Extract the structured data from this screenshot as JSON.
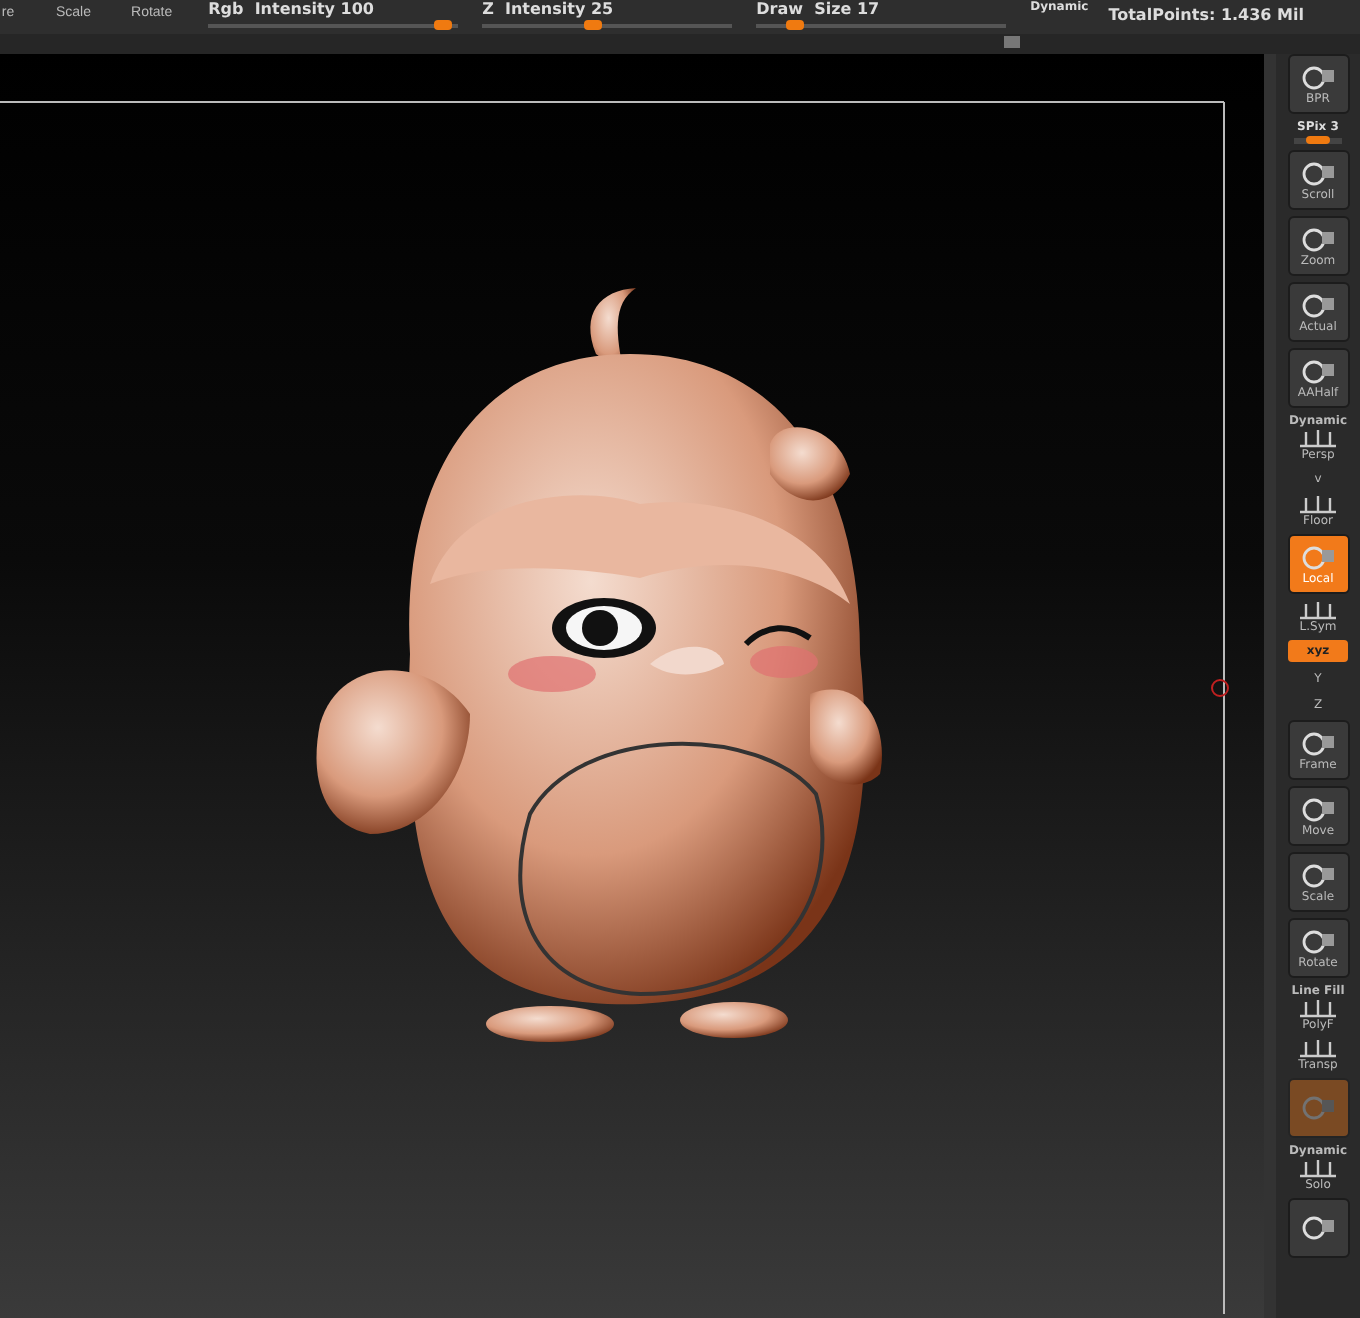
{
  "top_bar": {
    "tools": [
      {
        "label": "re"
      },
      {
        "label": "Scale"
      },
      {
        "label": "Rotate"
      }
    ],
    "sliders": [
      {
        "label": "Rgb",
        "name": "Intensity",
        "value": "100",
        "level": 0.94
      },
      {
        "label": "Z",
        "name": "Intensity",
        "value": "25",
        "level": 0.45
      },
      {
        "label": "Draw",
        "name": "Size",
        "value": "17",
        "level": 0.16
      }
    ],
    "dynamic_label": "Dynamic",
    "total_points": "TotalPoints: 1.436 Mil"
  },
  "toolbar": [
    {
      "kind": "button",
      "label": "BPR",
      "selected": false,
      "disabled": false
    },
    {
      "kind": "slider",
      "label": "SPix 3",
      "level": 0.5
    },
    {
      "kind": "button",
      "label": "Scroll",
      "selected": false,
      "disabled": false
    },
    {
      "kind": "button",
      "label": "Zoom",
      "selected": false,
      "disabled": false
    },
    {
      "kind": "button",
      "label": "Actual",
      "selected": false,
      "disabled": false
    },
    {
      "kind": "button",
      "label": "AAHalf",
      "selected": false,
      "disabled": false
    },
    {
      "kind": "flat",
      "header": "Dynamic",
      "label": "Persp",
      "selected": false,
      "disabled": false
    },
    {
      "kind": "chevron",
      "label": "v"
    },
    {
      "kind": "flat",
      "label": "Floor",
      "selected": false,
      "disabled": false
    },
    {
      "kind": "button",
      "label": "Local",
      "selected": true,
      "disabled": false
    },
    {
      "kind": "flat",
      "label": "L.Sym",
      "selected": false,
      "disabled": false
    },
    {
      "kind": "pill",
      "label": "xyz",
      "selected": true
    },
    {
      "kind": "mini",
      "label": "Y"
    },
    {
      "kind": "mini",
      "label": "Z"
    },
    {
      "kind": "button",
      "label": "Frame",
      "selected": false,
      "disabled": false
    },
    {
      "kind": "button",
      "label": "Move",
      "selected": false,
      "disabled": false
    },
    {
      "kind": "button",
      "label": "Scale",
      "selected": false,
      "disabled": false
    },
    {
      "kind": "button",
      "label": "Rotate",
      "selected": false,
      "disabled": false
    },
    {
      "kind": "flat",
      "header": "Line Fill",
      "label": "PolyF",
      "selected": false,
      "disabled": false
    },
    {
      "kind": "flat",
      "label": "Transp",
      "selected": false,
      "disabled": false
    },
    {
      "kind": "button",
      "selected": true,
      "disabled": true
    },
    {
      "kind": "flat",
      "header": "Dynamic",
      "label": "Solo",
      "selected": false,
      "disabled": false
    },
    {
      "kind": "button",
      "selected": false,
      "disabled": false
    }
  ]
}
